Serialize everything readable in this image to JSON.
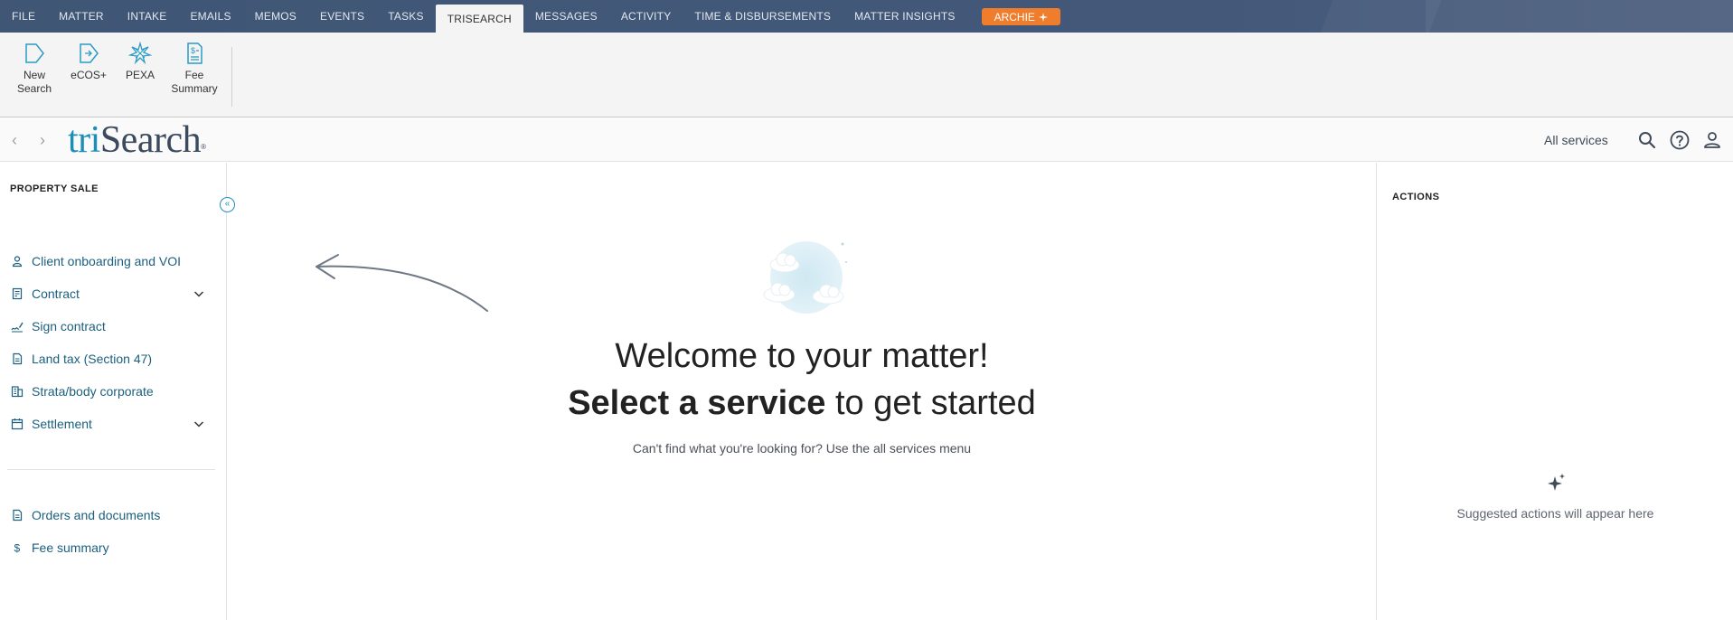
{
  "tabs": [
    {
      "label": "FILE"
    },
    {
      "label": "MATTER"
    },
    {
      "label": "INTAKE"
    },
    {
      "label": "EMAILS"
    },
    {
      "label": "MEMOS"
    },
    {
      "label": "EVENTS"
    },
    {
      "label": "TASKS"
    },
    {
      "label": "TRISEARCH",
      "active": true
    },
    {
      "label": "MESSAGES"
    },
    {
      "label": "ACTIVITY"
    },
    {
      "label": "TIME & DISBURSEMENTS"
    },
    {
      "label": "MATTER INSIGHTS"
    }
  ],
  "archie": {
    "label": "ARCHIE",
    "icon": "sparkle-icon"
  },
  "ribbon": {
    "new_search": {
      "line1": "New",
      "line2": "Search",
      "icon": "new-search-icon"
    },
    "ecos": {
      "line1": "eCOS+",
      "icon": "ecos-icon"
    },
    "pexa": {
      "line1": "PEXA",
      "icon": "pexa-icon"
    },
    "fee_summary": {
      "line1": "Fee",
      "line2": "Summary",
      "icon": "fee-summary-icon"
    }
  },
  "header": {
    "logo_tri": "tri",
    "logo_search": "Search",
    "logo_reg": "®",
    "all_services": "All services"
  },
  "sidebar": {
    "title": "PROPERTY SALE",
    "items": [
      {
        "label": "Client onboarding and VOI",
        "icon": "person-icon"
      },
      {
        "label": "Contract",
        "icon": "contract-icon",
        "expandable": true
      },
      {
        "label": "Sign contract",
        "icon": "signature-icon"
      },
      {
        "label": "Land tax (Section 47)",
        "icon": "document-icon"
      },
      {
        "label": "Strata/body corporate",
        "icon": "building-icon"
      },
      {
        "label": "Settlement",
        "icon": "calendar-icon",
        "expandable": true
      }
    ],
    "bottom_items": [
      {
        "label": "Orders and documents",
        "icon": "document-icon"
      },
      {
        "label": "Fee summary",
        "icon": "dollar-icon"
      }
    ]
  },
  "main": {
    "welcome_line1": "Welcome to your matter!",
    "welcome_bold": "Select a service",
    "welcome_rest": " to get started",
    "hint": "Can't find what you're looking for? Use the all services menu"
  },
  "actions": {
    "title": "ACTIONS",
    "empty_text": "Suggested actions will appear here"
  },
  "colors": {
    "topbar": "#44597a",
    "accent": "#1d8fb7",
    "archie": "#f07d2c",
    "sidebar_link": "#1b5f7e"
  }
}
